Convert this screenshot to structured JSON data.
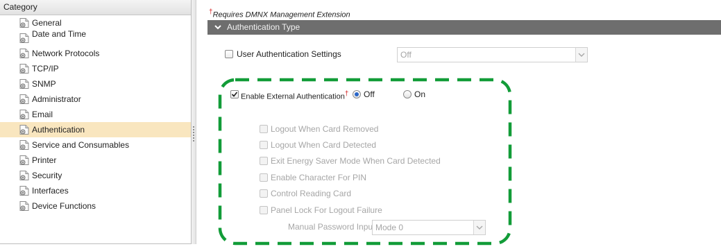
{
  "sidebar": {
    "header": "Category",
    "items": [
      {
        "label": "General",
        "icon": "document-icon",
        "selected": false
      },
      {
        "label": "Date and Time",
        "icon": "document-icon",
        "selected": false
      },
      {
        "label": "Network Protocols",
        "icon": "document-icon",
        "selected": false
      },
      {
        "label": "TCP/IP",
        "icon": "document-icon",
        "selected": false
      },
      {
        "label": "SNMP",
        "icon": "document-icon",
        "selected": false
      },
      {
        "label": "Administrator",
        "icon": "document-icon",
        "selected": false
      },
      {
        "label": "Email",
        "icon": "document-icon",
        "selected": false
      },
      {
        "label": "Authentication",
        "icon": "document-icon",
        "selected": true
      },
      {
        "label": "Service and Consumables",
        "icon": "document-icon",
        "selected": false
      },
      {
        "label": "Printer",
        "icon": "document-icon",
        "selected": false
      },
      {
        "label": "Security",
        "icon": "document-icon",
        "selected": false
      },
      {
        "label": "Interfaces",
        "icon": "document-icon",
        "selected": false
      },
      {
        "label": "Device Functions",
        "icon": "document-icon",
        "selected": false
      }
    ]
  },
  "main": {
    "note": "Requires DMNX Management Extension",
    "note_marker": "†",
    "section_title": "Authentication Type",
    "user_auth": {
      "label": "User Authentication Settings",
      "checked": false,
      "select_value": "Off"
    },
    "external_auth": {
      "label": "Enable External Authentication",
      "marker": "†",
      "checked": true,
      "options": [
        {
          "label": "Off",
          "selected": true
        },
        {
          "label": "On",
          "selected": false
        }
      ]
    },
    "sub_options": [
      {
        "label": "Logout When Card Removed",
        "checked": false,
        "enabled": false
      },
      {
        "label": "Logout When Card Detected",
        "checked": false,
        "enabled": false
      },
      {
        "label": "Exit Energy Saver Mode When Card Detected",
        "checked": false,
        "enabled": false
      },
      {
        "label": "Enable Character For PIN",
        "checked": false,
        "enabled": false
      },
      {
        "label": "Control Reading Card",
        "checked": false,
        "enabled": false
      },
      {
        "label": "Panel Lock For Logout Failure",
        "checked": false,
        "enabled": false
      }
    ],
    "manual_password": {
      "label": "Manual Password Input :",
      "select_value": "Mode 0"
    }
  },
  "colors": {
    "selected_row": "#f9e6bf",
    "section_bar": "#6e6e6e",
    "highlight_dash": "#129c38",
    "required_marker": "#d42020",
    "radio_dot": "#2a66c8"
  }
}
